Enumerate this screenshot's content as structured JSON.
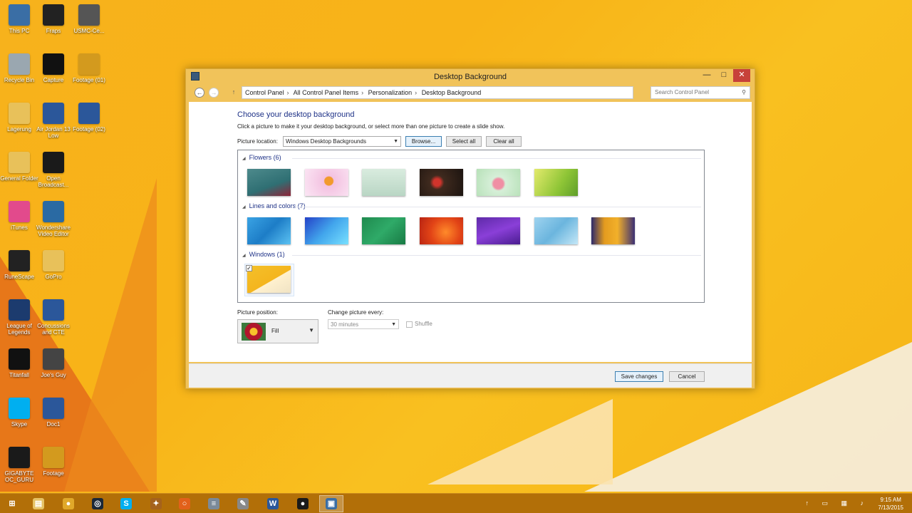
{
  "desktop": {
    "icons": [
      {
        "label": "This PC",
        "icon": "computer-icon",
        "color": "#3a6ea5"
      },
      {
        "label": "Fraps",
        "icon": "fraps-icon",
        "color": "#222222"
      },
      {
        "label": "USMC-Ce...",
        "icon": "folder-image-icon",
        "color": "#555555"
      },
      {
        "label": "Recycle Bin",
        "icon": "recycle-bin-icon",
        "color": "#9aa7b0"
      },
      {
        "label": "Capture",
        "icon": "video-file-icon",
        "color": "#111111"
      },
      {
        "label": "Footage (01)",
        "icon": "video-file-icon",
        "color": "#d39a1e"
      },
      {
        "label": "Lagerung",
        "icon": "folder-icon",
        "color": "#e8c15a"
      },
      {
        "label": "Air Jordan 13 Low",
        "icon": "word-doc-icon",
        "color": "#2b579a"
      },
      {
        "label": "Footage (02)",
        "icon": "audio-file-icon",
        "color": "#2b579a"
      },
      {
        "label": "General Folder",
        "icon": "folder-icon",
        "color": "#e8c15a"
      },
      {
        "label": "Open Broadcast...",
        "icon": "obs-icon",
        "color": "#1a1a1a"
      },
      {
        "label": "iTunes",
        "icon": "itunes-icon",
        "color": "#e24a8c"
      },
      {
        "label": "Wondershare Video Editor",
        "icon": "video-editor-icon",
        "color": "#2a6aa3"
      },
      {
        "label": "RuneScape",
        "icon": "runescape-icon",
        "color": "#222222"
      },
      {
        "label": "GoPro",
        "icon": "folder-icon",
        "color": "#e8c15a"
      },
      {
        "label": "League of Legends",
        "icon": "league-icon",
        "color": "#1c3b6e"
      },
      {
        "label": "Concussions and CTE",
        "icon": "word-doc-icon",
        "color": "#2b579a"
      },
      {
        "label": "Titanfall",
        "icon": "titanfall-icon",
        "color": "#111111"
      },
      {
        "label": "Joe's Guy",
        "icon": "image-file-icon",
        "color": "#444444"
      },
      {
        "label": "Skype",
        "icon": "skype-icon",
        "color": "#00aff0"
      },
      {
        "label": "Doc1",
        "icon": "word-doc-icon",
        "color": "#2b579a"
      },
      {
        "label": "GIGABYTE OC_GURU",
        "icon": "gigabyte-icon",
        "color": "#1a1a1a"
      },
      {
        "label": "Footage",
        "icon": "video-file-icon",
        "color": "#d39a1e"
      }
    ]
  },
  "window": {
    "title": "Desktop Background",
    "min_glyph": "—",
    "max_glyph": "□",
    "close_glyph": "✕",
    "address": {
      "back_glyph": "←",
      "forward_glyph": "→",
      "up_glyph": "↑",
      "breadcrumb": [
        "Control Panel",
        "All Control Panel Items",
        "Personalization",
        "Desktop Background"
      ],
      "search_placeholder": "Search Control Panel"
    },
    "heading": "Choose your desktop background",
    "subtext": "Click a picture to make it your desktop background, or select more than one picture to create a slide show.",
    "picture_location_label": "Picture location:",
    "picture_location_value": "Windows Desktop Backgrounds",
    "browse_label": "Browse...",
    "select_all_label": "Select all",
    "clear_all_label": "Clear all",
    "groups": [
      {
        "name": "Flowers (6)",
        "thumbs": [
          {
            "bg": "linear-gradient(160deg,#4d8a8c,#2f6f73 60%,#8e2438)"
          },
          {
            "bg": "radial-gradient(circle at 55% 45%,#f29a2d 0 6px,#f3c2e1 7px,#fbe6f4)"
          },
          {
            "bg": "linear-gradient(180deg,#d9ecdf,#b9d6c4)"
          },
          {
            "bg": "radial-gradient(circle at 40% 50%,#d0342c 0 5px,#3f2a1e 10px,#1c1410)"
          },
          {
            "bg": "radial-gradient(circle at 50% 55%,#f08fa4 0 7px,#d6efd8 10px,#b7e1b8)"
          },
          {
            "bg": "linear-gradient(120deg,#e3ea6c,#8ec536 60%,#5f9e2a)"
          }
        ]
      },
      {
        "name": "Lines and colors (7)",
        "thumbs": [
          {
            "bg": "linear-gradient(135deg,#3aa3e4,#1d7dc7 50%,#5cc2f2)"
          },
          {
            "bg": "linear-gradient(135deg,#2442c8,#42a6ec 50%,#78e0ff)"
          },
          {
            "bg": "linear-gradient(135deg,#1f8a4e,#2faa68 50%,#187a44)"
          },
          {
            "bg": "radial-gradient(circle at 60% 55%,#ff8a2a,#e24416 50%,#b82312)"
          },
          {
            "bg": "linear-gradient(160deg,#5e2aa8,#8a3fd8 50%,#4a1d90)"
          },
          {
            "bg": "linear-gradient(135deg,#9ed3ef,#6bb5de 50%,#c4e7f7)"
          },
          {
            "bg": "linear-gradient(90deg,#2d2a6a,#e39b1f 30%,#f2b02a 60%,#3b2f74)"
          }
        ]
      },
      {
        "name": "Windows (1)",
        "thumbs": [
          {
            "bg": "linear-gradient(150deg,#f3c02a,#f4b51e 55%,#fff1cf 56%,#f0e3c4)",
            "checked": true
          }
        ]
      }
    ],
    "picture_position_label": "Picture position:",
    "picture_position_value": "Fill",
    "change_every_label": "Change picture every:",
    "change_every_value": "30 minutes",
    "shuffle_label": "Shuffle",
    "save_label": "Save changes",
    "cancel_label": "Cancel"
  },
  "taskbar": {
    "items": [
      {
        "icon": "start-icon",
        "glyph": "⊞",
        "color": "#b26f08"
      },
      {
        "icon": "file-explorer-icon",
        "glyph": "▤",
        "color": "#e6c265"
      },
      {
        "icon": "chrome-canary-icon",
        "glyph": "●",
        "color": "#e0a82a"
      },
      {
        "icon": "steam-icon",
        "glyph": "◎",
        "color": "#1b2838"
      },
      {
        "icon": "skype-icon",
        "glyph": "S",
        "color": "#00aff0"
      },
      {
        "icon": "hearthstone-icon",
        "glyph": "✦",
        "color": "#a5621c"
      },
      {
        "icon": "origin-icon",
        "glyph": "○",
        "color": "#e2611a"
      },
      {
        "icon": "calculator-icon",
        "glyph": "≡",
        "color": "#7b8a99"
      },
      {
        "icon": "paint-icon",
        "glyph": "✎",
        "color": "#888888"
      },
      {
        "icon": "word-icon",
        "glyph": "W",
        "color": "#2b579a"
      },
      {
        "icon": "obs-icon",
        "glyph": "●",
        "color": "#1a1a1a"
      },
      {
        "icon": "control-panel-icon",
        "glyph": "▣",
        "color": "#3a6ea5"
      }
    ],
    "tray_glyphs": "↑ ▭ ▦ ♪",
    "time": "9:15 AM",
    "date": "7/13/2015"
  }
}
